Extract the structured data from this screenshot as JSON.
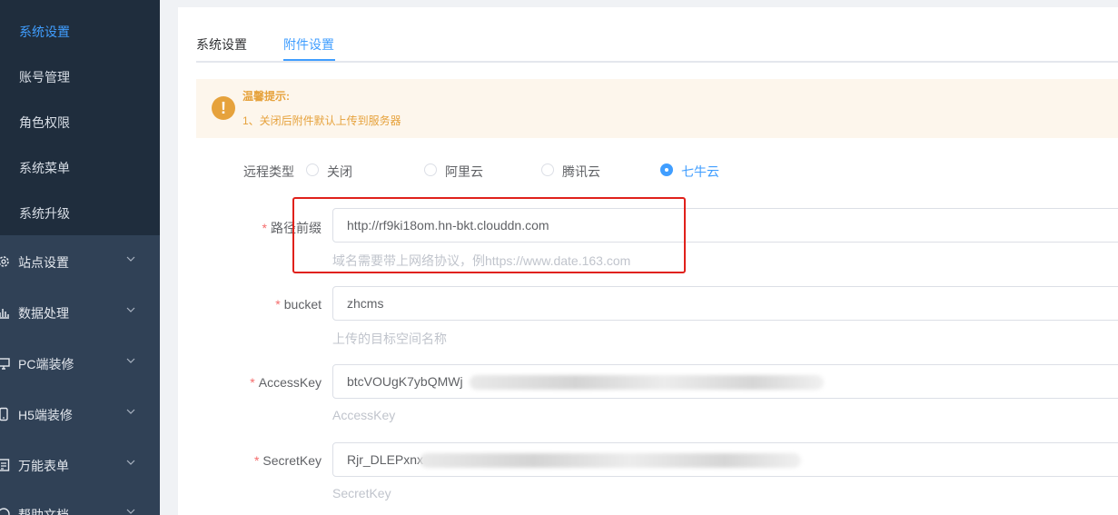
{
  "sidebar": {
    "sub_items": [
      "系统设置",
      "账号管理",
      "角色权限",
      "系统菜单",
      "系统升级"
    ],
    "groups": [
      {
        "label": "站点设置",
        "icon": "gear-icon"
      },
      {
        "label": "数据处理",
        "icon": "bar-chart-icon"
      },
      {
        "label": "PC端装修",
        "icon": "monitor-icon"
      },
      {
        "label": "H5端装修",
        "icon": "mobile-icon"
      },
      {
        "label": "万能表单",
        "icon": "form-icon"
      },
      {
        "label": "帮助文档",
        "icon": "help-icon"
      }
    ]
  },
  "tabs": [
    "系统设置",
    "附件设置"
  ],
  "alert": {
    "title": "温馨提示:",
    "text": "1、关闭后附件默认上传到服务器",
    "icon": "warning-icon"
  },
  "form": {
    "remote_type": {
      "label": "远程类型",
      "options": [
        "关闭",
        "阿里云",
        "腾讯云",
        "七牛云"
      ],
      "selected": "七牛云"
    },
    "path_prefix": {
      "label": "路径前缀",
      "value": "http://rf9ki18om.hn-bkt.clouddn.com",
      "help": "域名需要带上网络协议，例https://www.date.163.com"
    },
    "bucket": {
      "label": "bucket",
      "value": "zhcms",
      "help": "上传的目标空间名称"
    },
    "access_key": {
      "label": "AccessKey",
      "value": "btcVOUgK7ybQMWj",
      "help": "AccessKey"
    },
    "secret_key": {
      "label": "SecretKey",
      "value": "Rjr_DLEPxnx",
      "help": "SecretKey"
    }
  },
  "colors": {
    "sidebar": "#304156",
    "submenu": "#1f2d3d",
    "accent": "#409eff",
    "warning": "#e6a23c",
    "required": "#f56c6c",
    "highlight_box": "#e0211b"
  }
}
